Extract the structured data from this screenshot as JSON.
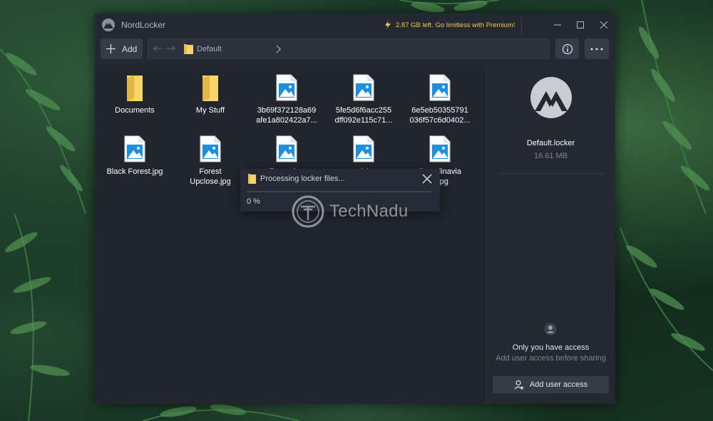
{
  "window": {
    "title": "NordLocker",
    "promo": "2.87 GB left. Go limitless with Premium!"
  },
  "toolbar": {
    "add_label": "Add",
    "breadcrumb": "Default"
  },
  "files": [
    {
      "name": "Documents",
      "type": "folder"
    },
    {
      "name": "My Stuff",
      "type": "folder"
    },
    {
      "name": "3b69f372128a69\nafe1a802422a7...",
      "type": "image"
    },
    {
      "name": "5fe5d6f6acc255\ndff092e115c71...",
      "type": "image"
    },
    {
      "name": "6e5eb50355791\n036f57c6d0402...",
      "type": "image"
    },
    {
      "name": "Black Forest.jpg",
      "type": "image"
    },
    {
      "name": "Forest\nUpclose.jpg",
      "type": "image"
    },
    {
      "name": "Forest.jpg",
      "type": "image"
    },
    {
      "name": "nick",
      "type": "image"
    },
    {
      "name": "Scandinavia\ng.jpg",
      "type": "image"
    }
  ],
  "progress": {
    "title": "Processing locker files...",
    "percent_label": "0 %",
    "value": 0
  },
  "locker": {
    "name": "Default.locker",
    "size": "16.61 MB",
    "access_title": "Only you have access",
    "access_subtitle": "Add user access before sharing",
    "add_user_label": "Add user access"
  },
  "watermark": "TechNadu",
  "colors": {
    "window_bg": "#232831",
    "content_bg": "#20252e",
    "button_bg": "#363c47",
    "promo": "#f2c94c",
    "folder": "#f6d36b",
    "image_icon": "#1e8ee0"
  },
  "icons": [
    "nordlocker-logo-icon",
    "lightning-icon",
    "minimize-icon",
    "maximize-icon",
    "close-icon",
    "plus-icon",
    "arrow-left-icon",
    "arrow-right-icon",
    "folder-icon",
    "chevron-right-icon",
    "info-icon",
    "more-icon",
    "image-file-icon",
    "user-icon",
    "add-user-icon"
  ]
}
